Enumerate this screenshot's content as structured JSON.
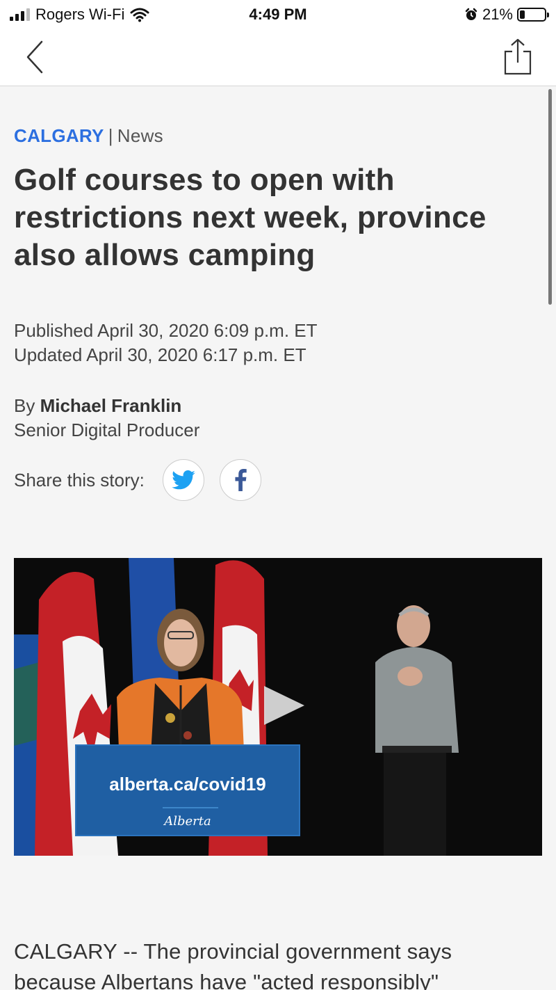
{
  "status_bar": {
    "carrier": "Rogers Wi-Fi",
    "time": "4:49 PM",
    "battery": "21%",
    "battery_level": 0.21
  },
  "nav": {
    "back_icon": "chevron-left-icon",
    "share_icon": "share-icon"
  },
  "article": {
    "kicker_city": "CALGARY",
    "kicker_separator": "|",
    "kicker_section": "News",
    "headline": "Golf courses to open with restrictions next week, province also allows camping",
    "published": "Published April 30, 2020 6:09 p.m. ET",
    "updated": "Updated April 30, 2020 6:17 p.m. ET",
    "byline_prefix": "By",
    "author": "Michael Franklin",
    "author_title": "Senior Digital Producer",
    "share_label": "Share this story:",
    "social": [
      {
        "name": "twitter-icon",
        "color": "#1da1f2"
      },
      {
        "name": "facebook-icon",
        "color": "#3b5998"
      }
    ]
  },
  "video": {
    "podium_url": "alberta.ca/covid19",
    "podium_logo": "Alberta",
    "play_icon": "play-icon"
  },
  "body": {
    "first_line": "CALGARY -- The provincial government says",
    "second_line": "because Albertans have \"acted responsibly\""
  },
  "colors": {
    "accent_blue": "#2c6fe0",
    "podium_blue": "#1f5fa3"
  }
}
